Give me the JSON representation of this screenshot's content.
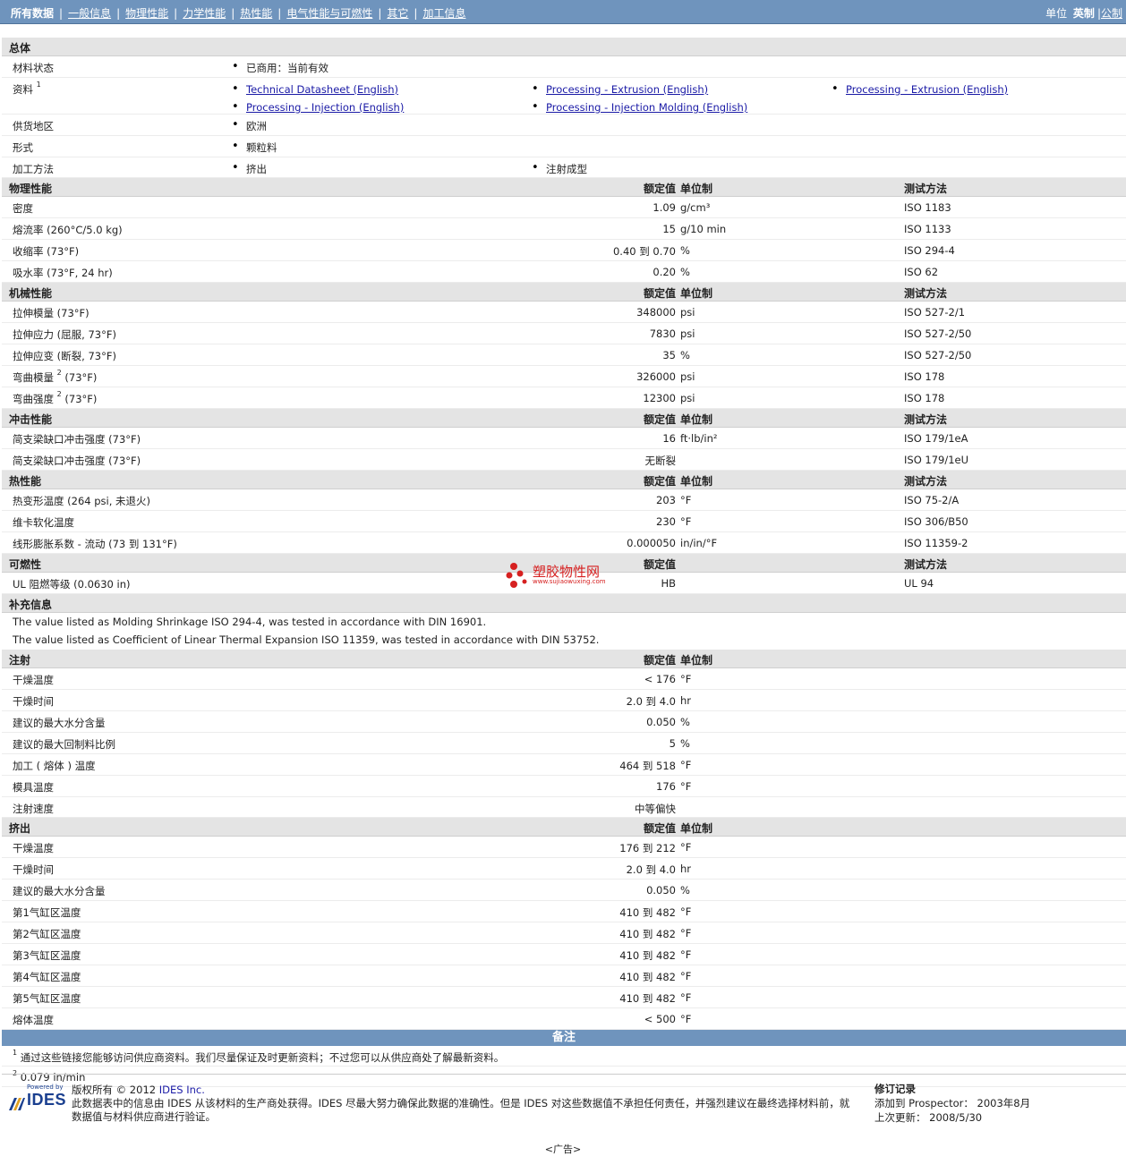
{
  "nav": {
    "items": [
      "所有数据",
      "一般信息",
      "物理性能",
      "力学性能",
      "热性能",
      "电气性能与可燃性",
      "其它",
      "加工信息"
    ],
    "units_label": "单位",
    "units_active": "英制",
    "units_other": "公制"
  },
  "general": {
    "title": "总体",
    "material_status_label": "材料状态",
    "material_status_value": "已商用：当前有效",
    "literature_label": "资料",
    "literature_sup": "1",
    "links": [
      "Technical Datasheet (English)",
      "Processing - Extrusion (English)",
      "Processing - Extrusion (English)",
      "Processing - Injection (English)",
      "Processing - Injection Molding (English)"
    ],
    "region_label": "供货地区",
    "region_value": "欧洲",
    "form_label": "形式",
    "form_value": "颗粒料",
    "method_label": "加工方法",
    "method_values": [
      "挤出",
      "注射成型"
    ]
  },
  "headers": {
    "nominal": "额定值",
    "unit": "单位制",
    "test": "测试方法"
  },
  "physical": {
    "title": "物理性能",
    "rows": [
      {
        "label": "密度",
        "value": "1.09",
        "unit": "g/cm³",
        "test": "ISO 1183"
      },
      {
        "label": "熔流率  (260°C/5.0 kg)",
        "value": "15",
        "unit": "g/10 min",
        "test": "ISO 1133"
      },
      {
        "label": "收缩率  (73°F)",
        "value": "0.40 到  0.70",
        "unit": "%",
        "test": "ISO 294-4"
      },
      {
        "label": "吸水率  (73°F, 24 hr)",
        "value": "0.20",
        "unit": "%",
        "test": "ISO 62"
      }
    ]
  },
  "mechanical": {
    "title": "机械性能",
    "rows": [
      {
        "label": "拉伸模量  (73°F)",
        "value": "348000",
        "unit": "psi",
        "test": "ISO 527-2/1"
      },
      {
        "label": "拉伸应力  (屈服, 73°F)",
        "value": "7830",
        "unit": "psi",
        "test": "ISO 527-2/50"
      },
      {
        "label": "拉伸应变  (断裂, 73°F)",
        "value": "35",
        "unit": "%",
        "test": "ISO 527-2/50"
      },
      {
        "label": "弯曲模量",
        "sup": "2",
        "label2": " (73°F)",
        "value": "326000",
        "unit": "psi",
        "test": "ISO 178"
      },
      {
        "label": "弯曲强度",
        "sup": "2",
        "label2": " (73°F)",
        "value": "12300",
        "unit": "psi",
        "test": "ISO 178"
      }
    ]
  },
  "impact": {
    "title": "冲击性能",
    "rows": [
      {
        "label": "简支梁缺口冲击强度  (73°F)",
        "value": "16",
        "unit": "ft·lb/in²",
        "test": "ISO 179/1eA"
      },
      {
        "label": "简支梁缺口冲击强度  (73°F)",
        "value": "无断裂",
        "unit": "",
        "test": "ISO 179/1eU"
      }
    ]
  },
  "thermal": {
    "title": "热性能",
    "rows": [
      {
        "label": "热变形温度  (264 psi, 未退火)",
        "value": "203",
        "unit": "°F",
        "test": "ISO 75-2/A"
      },
      {
        "label": "维卡软化温度",
        "value": "230",
        "unit": "°F",
        "test": "ISO 306/B50"
      },
      {
        "label": "线形膨胀系数  - 流动  (73 到  131°F)",
        "value": "0.000050",
        "unit": "in/in/°F",
        "test": "ISO 11359-2"
      }
    ]
  },
  "flammability": {
    "title": "可燃性",
    "rows": [
      {
        "label": "UL 阻燃等级  (0.0630 in)",
        "value": "HB",
        "unit": "",
        "test": "UL 94"
      }
    ]
  },
  "supplement": {
    "title": "补充信息",
    "lines": [
      "The value listed as Molding Shrinkage ISO 294-4, was tested in accordance with DIN 16901.",
      "The value listed as Coefficient of Linear Thermal Expansion ISO 11359, was tested in accordance with DIN 53752."
    ]
  },
  "injection": {
    "title": "注射",
    "rows": [
      {
        "label": "干燥温度",
        "value": "< 176",
        "unit": "°F"
      },
      {
        "label": "干燥时间",
        "value": "2.0 到  4.0",
        "unit": "hr"
      },
      {
        "label": "建议的最大水分含量",
        "value": "0.050",
        "unit": "%"
      },
      {
        "label": "建议的最大回制料比例",
        "value": "5",
        "unit": "%"
      },
      {
        "label": "加工 ( 熔体 ) 温度",
        "value": "464 到  518",
        "unit": "°F"
      },
      {
        "label": "模具温度",
        "value": "176",
        "unit": "°F"
      },
      {
        "label": "注射速度",
        "value": "中等偏快",
        "unit": ""
      }
    ]
  },
  "extrusion": {
    "title": "挤出",
    "rows": [
      {
        "label": "干燥温度",
        "value": "176 到  212",
        "unit": "°F"
      },
      {
        "label": "干燥时间",
        "value": "2.0 到  4.0",
        "unit": "hr"
      },
      {
        "label": "建议的最大水分含量",
        "value": "0.050",
        "unit": "%"
      },
      {
        "label": "第1气缸区温度",
        "value": "410 到  482",
        "unit": "°F"
      },
      {
        "label": "第2气缸区温度",
        "value": "410 到  482",
        "unit": "°F"
      },
      {
        "label": "第3气缸区温度",
        "value": "410 到  482",
        "unit": "°F"
      },
      {
        "label": "第4气缸区温度",
        "value": "410 到  482",
        "unit": "°F"
      },
      {
        "label": "第5气缸区温度",
        "value": "410 到  482",
        "unit": "°F"
      },
      {
        "label": "熔体温度",
        "value": "< 500",
        "unit": "°F"
      }
    ]
  },
  "remarks": {
    "title": "备注",
    "notes": [
      {
        "sup": "1",
        "text": "通过这些链接您能够访问供应商资料。我们尽量保证及时更新资料；不过您可以从供应商处了解最新资料。"
      },
      {
        "sup": "2",
        "text": "0.079 in/min"
      }
    ]
  },
  "footer": {
    "logo_small": "Powered by",
    "logo_text": "IDES",
    "copyright_prefix": "版权所有  © 2012 ",
    "copyright_link": "IDES Inc.",
    "disclaimer": "此数据表中的信息由  IDES 从该材料的生产商处获得。IDES 尽最大努力确保此数据的准确性。但是  IDES 对这些数据值不承担任何责任，并强烈建议在最终选择材料前，就数据值与材料供应商进行验证。",
    "revision_title": "修订记录",
    "added_label": "添加到  Prospector：  2003年8月",
    "updated_label": "上次更新：   2008/5/30",
    "ad": "<广告>"
  },
  "watermark": {
    "title": "塑胶物性网",
    "url": "www.sujiaowuxing.com"
  }
}
